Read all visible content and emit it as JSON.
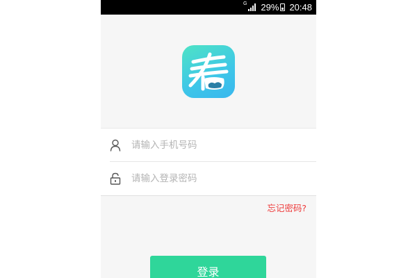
{
  "status_bar": {
    "network_type": "G",
    "battery_percent": "29%",
    "time": "20:48",
    "signal_icon": "signal-bars-icon",
    "battery_icon": "battery-icon"
  },
  "logo": {
    "text": "看",
    "icon": "app-logo-icon",
    "gradient": [
      "#4ee3c5",
      "#39b7ee"
    ]
  },
  "form": {
    "phone": {
      "placeholder": "请输入手机号码",
      "value": "",
      "icon": "user-icon"
    },
    "password": {
      "placeholder": "请输入登录密码",
      "value": "",
      "icon": "lock-icon"
    }
  },
  "forgot_password": "忘记密码?",
  "login_button": "登录",
  "colors": {
    "accent": "#2fd69a",
    "link": "#ee3b3b",
    "background": "#f6f6f6"
  }
}
